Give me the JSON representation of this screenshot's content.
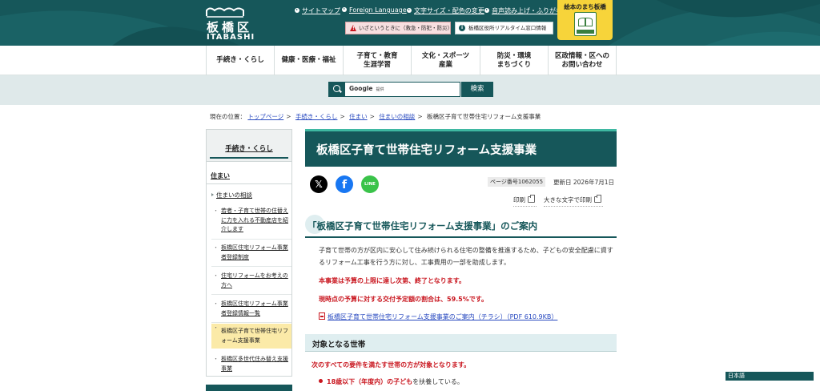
{
  "header": {
    "logo_jp": "板橋区",
    "logo_en": "ITABASHI",
    "util_links": [
      {
        "label": "サイトマップ"
      },
      {
        "label": "Foreign Language"
      },
      {
        "label": "文字サイズ・配色の変更"
      },
      {
        "label": "音声読み上げ・ふりがな"
      }
    ],
    "emergency_label": "いざというときに（救急・防犯・防災）",
    "realtime_label": "板橋区役所リアルタイム窓口情報",
    "ehon_label": "絵本のまち板橋",
    "colors": {
      "primary": "#16575a",
      "accent": "#3fb8a2",
      "yellow": "#f7d43a",
      "red": "#c9161f"
    }
  },
  "gnav": [
    {
      "label": "手続き・くらし"
    },
    {
      "label": "健康・医療・福祉"
    },
    {
      "label": "子育て・教育\n生涯学習"
    },
    {
      "label": "文化・スポーツ\n産業"
    },
    {
      "label": "防災・環境\nまちづくり"
    },
    {
      "label": "区政情報・区への\nお問い合わせ"
    }
  ],
  "search": {
    "placeholder_brand": "Google",
    "placeholder_suffix": "提供",
    "button": "検索"
  },
  "breadcrumb": {
    "prefix": "現在の位置：",
    "items": [
      "トップページ",
      "手続き・くらし",
      "住まい",
      "住まいの相談"
    ],
    "current": "板橋区子育て世帯住宅リフォーム支援事業"
  },
  "sidenav": {
    "top": "手続き・くらし",
    "heading": "住まい",
    "l2": "住まいの相談",
    "items": [
      {
        "label": "若者・子育て世帯の住替えに力を入れる不動産店を紹介します"
      },
      {
        "label": "板橋区住宅リフォーム事業者登録制度"
      },
      {
        "label": "住宅リフォームをお考えの方へ"
      },
      {
        "label": "板橋区住宅リフォーム事業者登録情報一覧"
      },
      {
        "label": "板橋区子育て世帯住宅リフォーム支援事業"
      },
      {
        "label": "板橋区多世代住み替え支援事業"
      }
    ]
  },
  "main": {
    "title": "板橋区子育て世帯住宅リフォーム支援事業",
    "social": {
      "x": "𝕏",
      "facebook": "f",
      "line": "LINE"
    },
    "page_number": "ページ番号1062055",
    "updated": "更新日 2026年7月1日",
    "print": "印刷",
    "print_large": "大きな文字で印刷",
    "h2": "「板橋区子育て世帯住宅リフォーム支援事業」のご案内",
    "intro": "子育て世帯の方が区内に安心して住み続けられる住宅の整備を推進するため、子どもの安全配慮に資するリフォーム工事を行う方に対し、工事費用の一部を助成します。",
    "notice1": "本事業は予算の上限に達し次第、終了となります。",
    "notice2": "現時点の予算に対する交付予定額の割合は、59.5%です。",
    "pdf_link": "板橋区子育て世帯住宅リフォーム支援事業のご案内（チラシ）（PDF 610.9KB）",
    "h3": "対象となる世帯",
    "cond": "次のすべての要件を満たす世帯の方が対象となります。",
    "li1_em": "18歳以下（年度内）の子ども",
    "li1_rest": "を扶養している。"
  },
  "lang": "日本語"
}
